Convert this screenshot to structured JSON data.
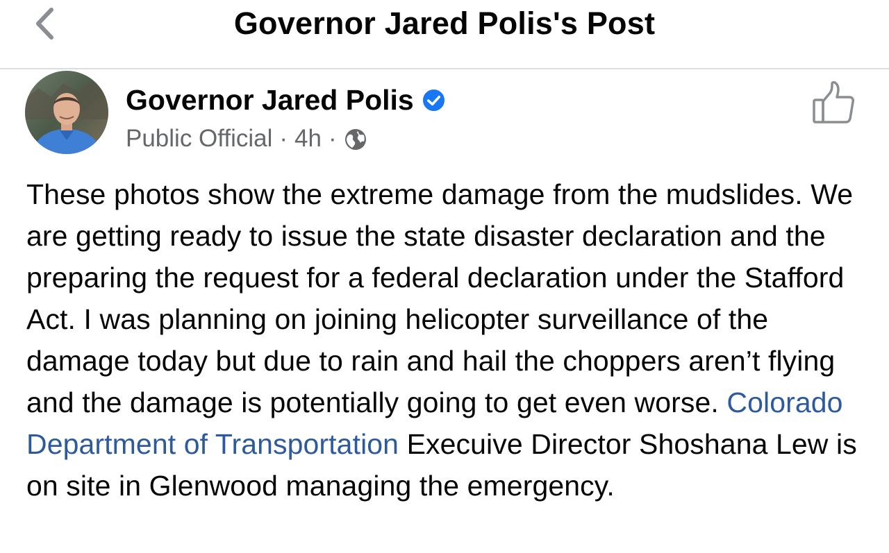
{
  "header": {
    "title": "Governor Jared Polis's Post",
    "back_icon": "chevron-left-icon"
  },
  "post": {
    "author": {
      "name": "Governor Jared Polis",
      "verified": true,
      "avatar_icon": "profile-photo"
    },
    "meta": {
      "category": "Public Official",
      "separator": "·",
      "time": "4h",
      "audience_icon": "globe-icon"
    },
    "like_icon": "thumbs-up-icon",
    "body": {
      "text_1": "These photos show the extreme damage from the mudslides. We are getting ready to issue the state disaster declaration and the preparing the request for a federal declaration under the Stafford Act. I was planning on joining helicopter surveillance of the damage today but due to rain and hail the choppers aren’t flying and the damage is potentially going to get even worse. ",
      "link_text": "Colorado Department of Transportation",
      "text_2": " Execuive Director Shoshana Lew is on site in Glenwood managing the emergency."
    }
  },
  "colors": {
    "link": "#2d5a9c",
    "muted": "#65676b",
    "verified": "#1877f2",
    "divider": "#dcdde1"
  }
}
